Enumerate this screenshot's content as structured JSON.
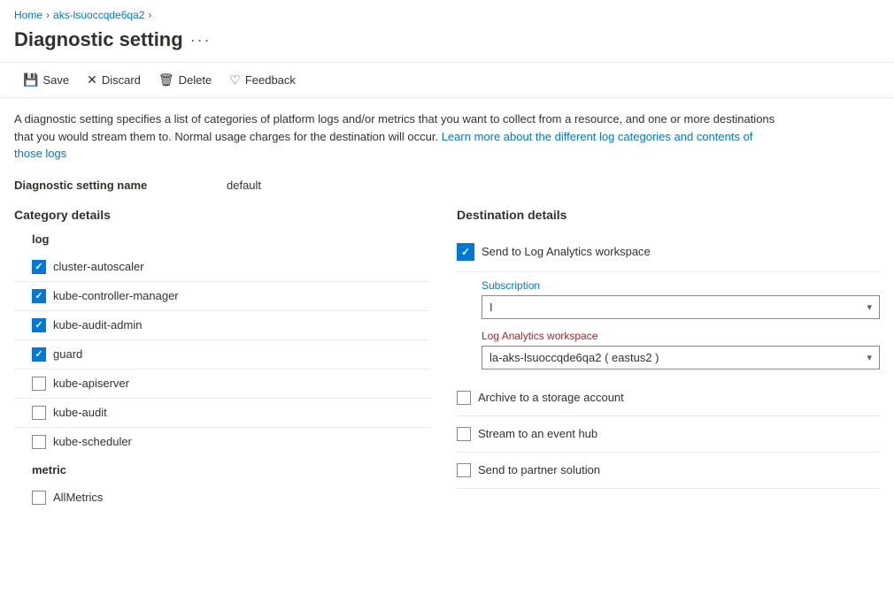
{
  "breadcrumb": {
    "home": "Home",
    "resource": "aks-lsuoccqde6qa2"
  },
  "page": {
    "title": "Diagnostic setting",
    "ellipsis": "···"
  },
  "toolbar": {
    "save": "Save",
    "discard": "Discard",
    "delete": "Delete",
    "feedback": "Feedback"
  },
  "description": {
    "text1": "A diagnostic setting specifies a list of categories of platform logs and/or metrics that you want to collect from a resource, and one or more destinations that you would stream them to. Normal usage charges for the destination will occur.",
    "link_text": "Learn more about the different log categories and contents of those logs",
    "link_href": "#"
  },
  "setting_name": {
    "label": "Diagnostic setting name",
    "value": "default"
  },
  "category_details": {
    "title": "Category details",
    "log_section": "log",
    "items": [
      {
        "id": "cluster-autoscaler",
        "label": "cluster-autoscaler",
        "checked": true
      },
      {
        "id": "kube-controller-manager",
        "label": "kube-controller-manager",
        "checked": true
      },
      {
        "id": "kube-audit-admin",
        "label": "kube-audit-admin",
        "checked": true
      },
      {
        "id": "guard",
        "label": "guard",
        "checked": true
      },
      {
        "id": "kube-apiserver",
        "label": "kube-apiserver",
        "checked": false
      },
      {
        "id": "kube-audit",
        "label": "kube-audit",
        "checked": false
      },
      {
        "id": "kube-scheduler",
        "label": "kube-scheduler",
        "checked": false
      }
    ],
    "metric_section": "metric",
    "metric_items": [
      {
        "id": "AllMetrics",
        "label": "AllMetrics",
        "checked": false
      }
    ]
  },
  "destination_details": {
    "title": "Destination details",
    "send_to_log_analytics": {
      "label": "Send to Log Analytics workspace",
      "checked": true
    },
    "subscription": {
      "label": "Subscription",
      "value": "I",
      "required": false
    },
    "log_analytics_workspace": {
      "label": "Log Analytics workspace",
      "value": "la-aks-lsuoccqde6qa2 ( eastus2 )",
      "required": true
    },
    "archive_storage": {
      "label": "Archive to a storage account",
      "checked": false
    },
    "stream_event_hub": {
      "label": "Stream to an event hub",
      "checked": false
    },
    "partner_solution": {
      "label": "Send to partner solution",
      "checked": false
    }
  }
}
